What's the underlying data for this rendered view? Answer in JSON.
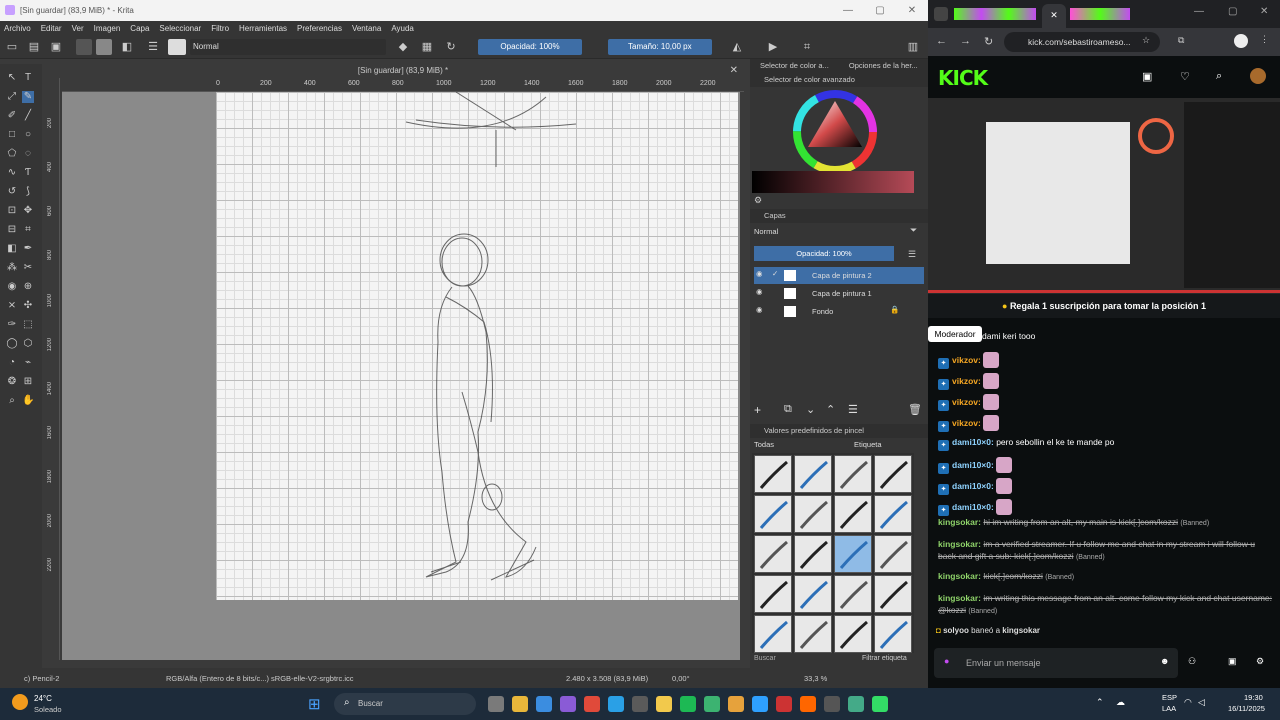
{
  "krita": {
    "window_title": "[Sin guardar]  (83,9 MiB) *  - Krita",
    "menu": [
      "Archivo",
      "Editar",
      "Ver",
      "Imagen",
      "Capa",
      "Seleccionar",
      "Filtro",
      "Herramientas",
      "Preferencias",
      "Ventana",
      "Ayuda"
    ],
    "toolbar": {
      "blend_mode": "Normal",
      "opacity": "Opacidad: 100%",
      "size": "Tamaño: 10,00 px"
    },
    "doc_tab": "[Sin guardar]  (83,9 MiB) *",
    "ruler_h": [
      "0",
      "200",
      "400",
      "600",
      "800",
      "1000",
      "1200",
      "1400",
      "1600",
      "1800",
      "2000",
      "2200"
    ],
    "ruler_v": [
      "200",
      "400",
      "600",
      "800",
      "1000",
      "1200",
      "1400",
      "1600",
      "1800",
      "2000",
      "2200"
    ],
    "docks": {
      "tab1": "Selector de color a...",
      "tab2": "Opciones de la her...",
      "color_title": "Selector de color avanzado",
      "layers_title": "Capas",
      "layers_mode": "Normal",
      "layers_opacity": "Opacidad: 100%",
      "layers": [
        {
          "name": "Capa de pintura 2"
        },
        {
          "name": "Capa de pintura 1"
        },
        {
          "name": "Fondo"
        }
      ],
      "brush_title": "Valores predefinidos de pincel",
      "brush_filter": "Todas",
      "brush_tag": "Etiqueta",
      "brush_search": "Buscar",
      "brush_filter_tag": "Filtrar etiqueta"
    },
    "status": {
      "brush": "c) Pencil-2",
      "colorspace": "RGB/Alfa (Entero de 8 bits/c...)  sRGB-elle-V2-srgbtrc.icc",
      "dimensions": "2.480 x 3.508 (83,9 MiB)",
      "rotation": "0,00°",
      "zoom": "33,3 %"
    }
  },
  "browser": {
    "address": "kick.com/sebastiroameso...",
    "kick_logo": "KICK",
    "pinned_banner": "Regala 1 suscripción para tomar la posición 1",
    "tooltip": "Moderador",
    "messages": [
      {
        "user": "",
        "text": "dami keri tooo",
        "color": "#ffffff"
      },
      {
        "user": "vikzov:",
        "text": "",
        "emote": true,
        "color": "#f5a623"
      },
      {
        "user": "vikzov:",
        "text": "",
        "emote": true,
        "color": "#f5a623"
      },
      {
        "user": "vikzov:",
        "text": "",
        "emote": true,
        "color": "#f5a623"
      },
      {
        "user": "vikzov:",
        "text": "",
        "emote": true,
        "color": "#f5a623"
      },
      {
        "user": "dami10×0:",
        "text": "pero sebollin el ke te mande po",
        "color": "#8fd3ff"
      },
      {
        "user": "dami10×0:",
        "text": "",
        "emote": true,
        "color": "#8fd3ff"
      },
      {
        "user": "dami10×0:",
        "text": "",
        "emote": true,
        "color": "#8fd3ff"
      },
      {
        "user": "dami10×0:",
        "text": "",
        "emote": true,
        "color": "#8fd3ff"
      }
    ],
    "banned_messages": [
      {
        "user": "kingsokar:",
        "text": "hi im writing from an alt, my main is kick[.]com/kozzi",
        "tag": "(Banned)"
      },
      {
        "user": "kingsokar:",
        "text": "im a verified streamer. If u follow me and chat in my stream i will follow u back and gift a sub: kick[.]com/kozzi",
        "tag": "(Banned)"
      },
      {
        "user": "kingsokar:",
        "text": "kick[.]com/kozzi",
        "tag": "(Banned)"
      },
      {
        "user": "kingsokar:",
        "text": "im writing this message from an alt. come follow my kick and chat username: @kozzi",
        "tag": "(Banned)"
      }
    ],
    "ban_notice": {
      "actor": "solyoo",
      "action": "baneó a",
      "target": "kingsokar"
    },
    "chat_placeholder": "Enviar un mensaje"
  },
  "taskbar": {
    "weather_temp": "24°C",
    "weather_desc": "Soleado",
    "search": "Buscar",
    "lang": "ESP",
    "lang2": "LAA",
    "time": "19:30",
    "date": "16/11/2025"
  }
}
